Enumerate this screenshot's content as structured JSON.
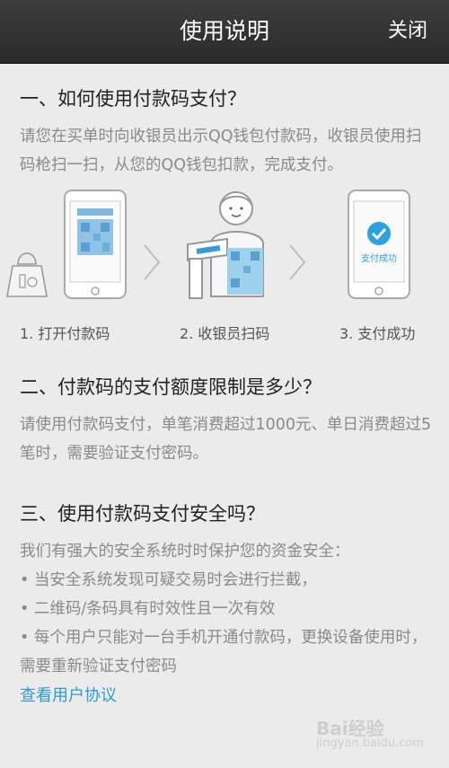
{
  "header": {
    "title": "使用说明",
    "close_label": "关闭"
  },
  "sections": {
    "s1": {
      "heading": "一、如何使用付款码支付？",
      "paragraph": "请您在买单时向收银员出示QQ钱包付款码，收银员使用扫码枪扫一扫，从您的QQ钱包扣款，完成支付。"
    },
    "steps": {
      "step1": "1. 打开付款码",
      "step2": "2. 收银员扫码",
      "step3": "3. 支付成功",
      "success_badge": "支付成功"
    },
    "s2": {
      "heading": "二、付款码的支付额度限制是多少？",
      "paragraph": "请使用付款码支付，单笔消费超过1000元、单日消费超过5笔时，需要验证支付密码。"
    },
    "s3": {
      "heading": "三、使用付款码支付安全吗？",
      "intro": "我们有强大的安全系统时时保护您的资金安全：",
      "bullets": [
        "• 当安全系统发现可疑交易时会进行拦截，",
        "• 二维码/条码具有时效性且一次有效",
        "• 每个用户只能对一台手机开通付款码，更换设备使用时，需要重新验证支付密码"
      ],
      "link": "查看用户协议"
    }
  },
  "watermark": {
    "brand": "Bai经验",
    "url": "jingyan.baidu.com"
  },
  "colors": {
    "header_bg": "#2f2f2f",
    "link": "#2b9bd6",
    "body_text": "#8a8a8a",
    "accent_blue": "#2aa3e0"
  }
}
